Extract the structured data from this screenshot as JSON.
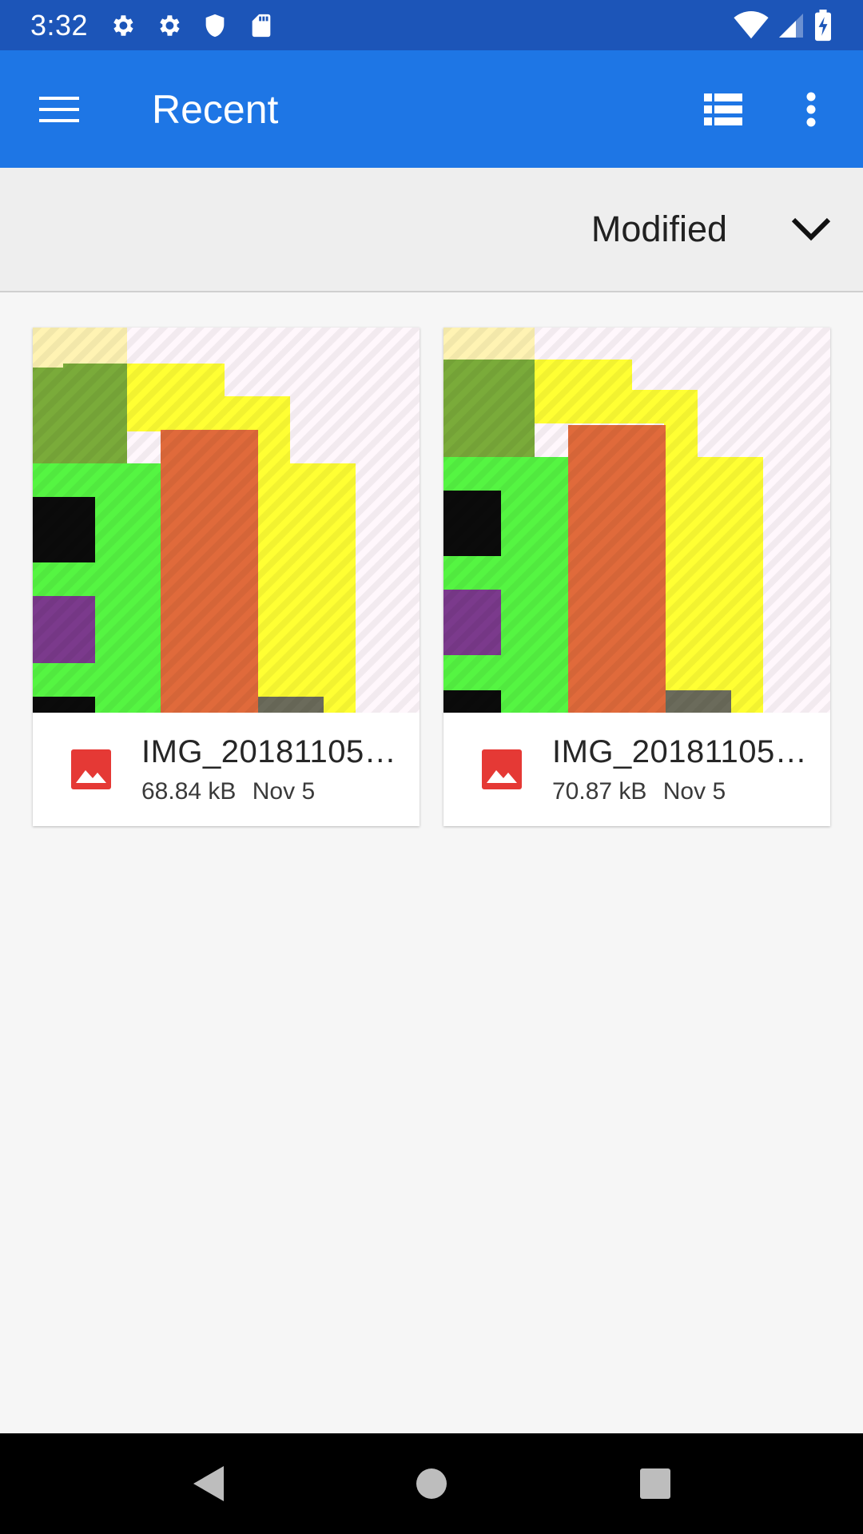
{
  "status_bar": {
    "time": "3:32",
    "left_icons": [
      "gear-icon",
      "gear-icon",
      "shield-icon",
      "sd-card-icon"
    ],
    "right_icons": [
      "wifi-icon",
      "cell-signal-icon",
      "battery-charging-icon"
    ]
  },
  "app_bar": {
    "title": "Recent",
    "background": "#1e76e5",
    "actions": [
      "list-view-icon",
      "more-vert-icon"
    ]
  },
  "sort_bar": {
    "label": "Modified"
  },
  "files": [
    {
      "name": "IMG_20181105…",
      "size": "68.84 kB",
      "date": "Nov 5",
      "icon": "image-file-icon",
      "icon_color": "#e53935"
    },
    {
      "name": "IMG_20181105…",
      "size": "70.87 kB",
      "date": "Nov 5",
      "icon": "image-file-icon",
      "icon_color": "#e53935"
    }
  ],
  "colors": {
    "status_bar": "#1c55b8",
    "app_bar": "#1e76e5",
    "background": "#f6f6f6"
  }
}
